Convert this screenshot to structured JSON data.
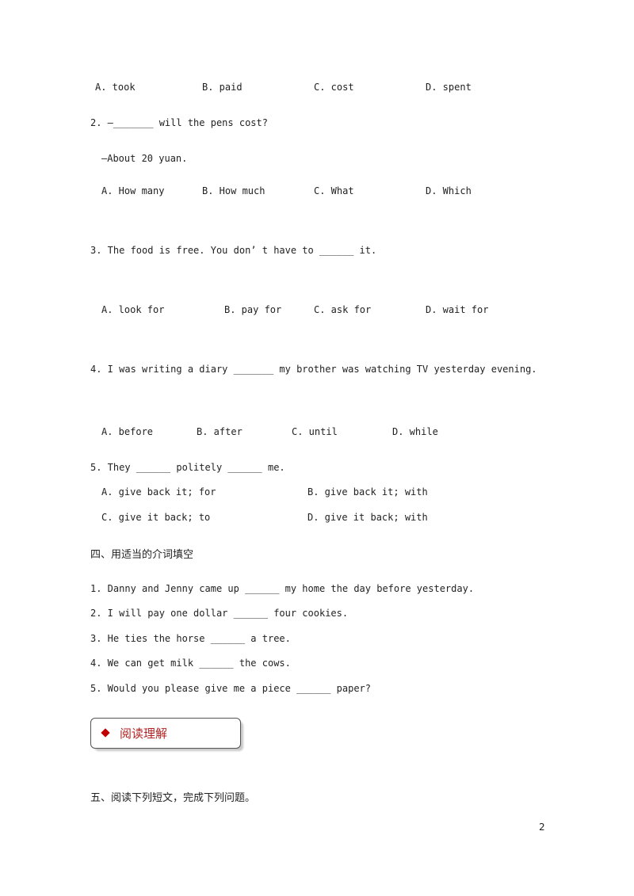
{
  "q1_options": [
    "A. took",
    "B. paid",
    "C. cost",
    "D. spent"
  ],
  "q2": {
    "stem": "2. —_______ will the pens cost?",
    "reply": "—About 20 yuan.",
    "options": [
      "A. How many",
      "B. How much",
      "C. What",
      "D. Which"
    ]
  },
  "q3": {
    "stem": "3. The food is free. You don’ t have to ______ it.",
    "options": [
      "A. look for",
      "B. pay for",
      "C. ask for",
      "D. wait for"
    ]
  },
  "q4": {
    "stem": "4. I was writing a diary _______ my brother was watching TV yesterday evening.",
    "options": [
      "A. before",
      "B. after",
      "C. until",
      "D. while"
    ]
  },
  "q5": {
    "stem": "5. They ______ politely ______ me.",
    "options": [
      "A. give back it; for",
      "B. give back it; with",
      "C. give it back; to",
      "D. give it back; with"
    ]
  },
  "section4": {
    "title": "四、用适当的介词填空",
    "items": [
      "1. Danny and Jenny came up ______ my home the day before yesterday.",
      "2. I will pay one dollar ______ four cookies.",
      "3. He ties the horse ______ a tree.",
      "4. We can get milk ______ the cows.",
      "5. Would you please give me a piece ______ paper?"
    ]
  },
  "reading_box": {
    "title": "阅读理解",
    "accent": "#c00000"
  },
  "section5": {
    "title": "五、阅读下列短文，完成下列问题。"
  },
  "page_number": "2"
}
